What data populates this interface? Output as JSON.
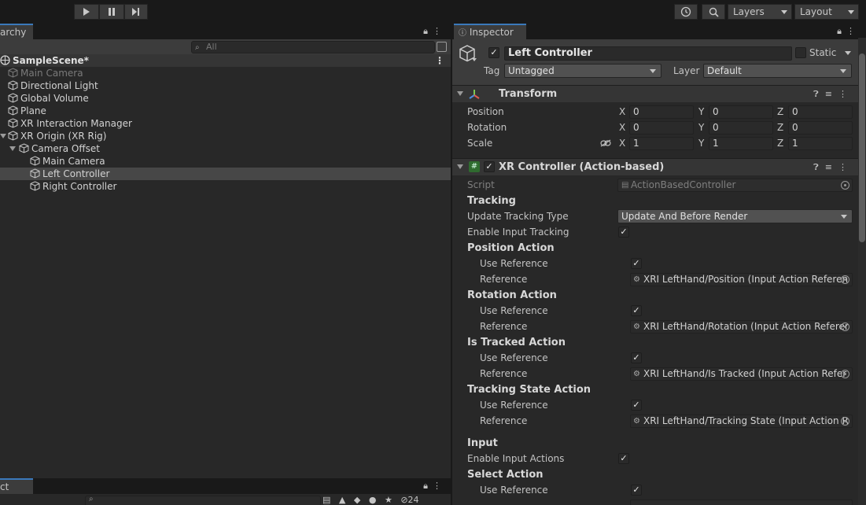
{
  "toolbar": {
    "play_icon": "play-icon",
    "pause_icon": "pause-icon",
    "step_icon": "step-icon",
    "layers_label": "Layers",
    "layout_label": "Layout"
  },
  "hierarchy": {
    "tab_label": "archy",
    "search_placeholder": "All",
    "scene_name": "SampleScene*",
    "items": [
      {
        "label": "Main Camera"
      },
      {
        "label": "Directional Light"
      },
      {
        "label": "Global Volume"
      },
      {
        "label": "Plane"
      },
      {
        "label": "XR Interaction Manager"
      },
      {
        "label": "XR Origin (XR Rig)"
      },
      {
        "label": "Camera Offset"
      },
      {
        "label": "Main Camera"
      },
      {
        "label": "Left Controller"
      },
      {
        "label": "Right Controller"
      }
    ]
  },
  "project": {
    "tab_label": "ct",
    "hidden_count": "24"
  },
  "inspector": {
    "tab_label": "Inspector",
    "object_name": "Left Controller",
    "static_label": "Static",
    "tag_label": "Tag",
    "tag_value": "Untagged",
    "layer_label": "Layer",
    "layer_value": "Default",
    "transform": {
      "title": "Transform",
      "position_label": "Position",
      "rotation_label": "Rotation",
      "scale_label": "Scale",
      "x_label": "X",
      "y_label": "Y",
      "z_label": "Z",
      "position": {
        "x": "0",
        "y": "0",
        "z": "0"
      },
      "rotation": {
        "x": "0",
        "y": "0",
        "z": "0"
      },
      "scale": {
        "x": "1",
        "y": "1",
        "z": "1"
      }
    },
    "xr_controller": {
      "title": "XR Controller (Action-based)",
      "script_label": "Script",
      "script_value": "ActionBasedController",
      "tracking_header": "Tracking",
      "update_tracking_type_label": "Update Tracking Type",
      "update_tracking_type_value": "Update And Before Render",
      "enable_input_tracking_label": "Enable Input Tracking",
      "position_action_header": "Position Action",
      "rotation_action_header": "Rotation Action",
      "is_tracked_action_header": "Is Tracked Action",
      "tracking_state_action_header": "Tracking State Action",
      "use_reference_label": "Use Reference",
      "reference_label": "Reference",
      "position_reference": "XRI LeftHand/Position (Input Action Referen",
      "rotation_reference": "XRI LeftHand/Rotation (Input Action Referer",
      "is_tracked_reference": "XRI LeftHand/Is Tracked (Input Action Refer",
      "tracking_state_reference": "XRI LeftHand/Tracking State (Input Action R",
      "input_header": "Input",
      "enable_input_actions_label": "Enable Input Actions",
      "select_action_header": "Select Action"
    }
  }
}
